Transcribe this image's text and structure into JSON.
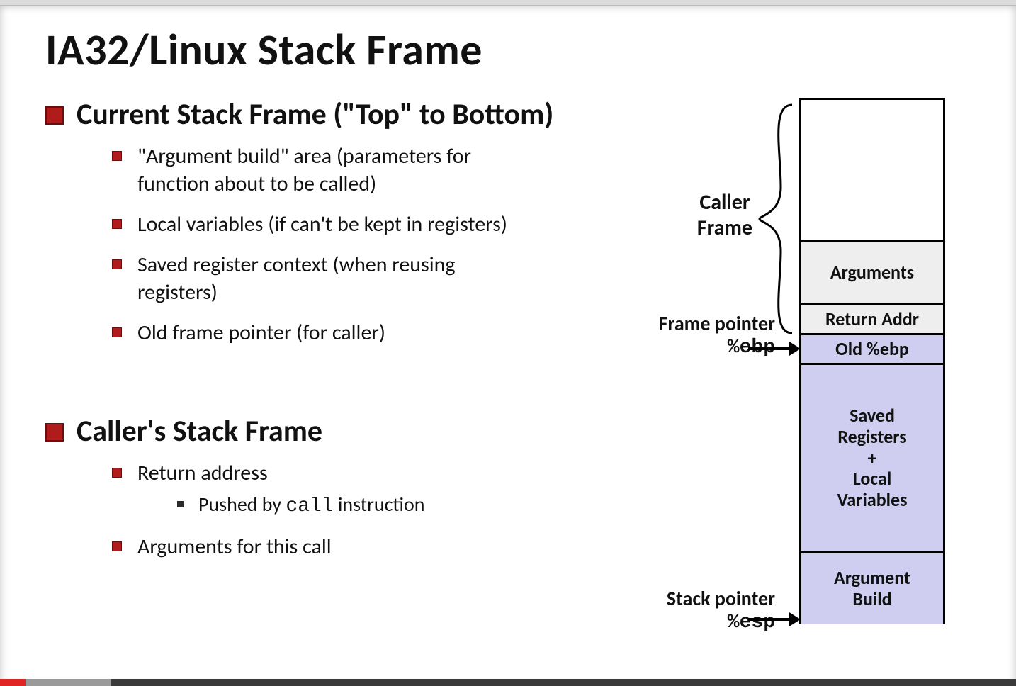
{
  "title": "IA32/Linux Stack Frame",
  "sections": [
    {
      "heading": "Current Stack Frame (\"Top\" to Bottom)",
      "items": [
        {
          "text": "\"Argument build\" area (parameters for function about to be called)"
        },
        {
          "text": "Local variables (if can't be kept in registers)"
        },
        {
          "text": "Saved register context (when reusing registers)"
        },
        {
          "text": "Old frame pointer (for caller)"
        }
      ]
    },
    {
      "heading": "Caller's Stack Frame",
      "items": [
        {
          "text": "Return address",
          "sub": [
            {
              "pre": "Pushed by ",
              "mono": "call",
              "post": " instruction"
            }
          ]
        },
        {
          "text": "Arguments for this call"
        }
      ]
    }
  ],
  "diagram": {
    "caller_label_line1": "Caller",
    "caller_label_line2": "Frame",
    "frame_pointer_label": "Frame pointer",
    "frame_pointer_reg": "%ebp",
    "stack_pointer_label": "Stack pointer",
    "stack_pointer_reg": "%esp",
    "cells": {
      "arguments": "Arguments",
      "return_addr": "Return Addr",
      "old_ebp": "Old %ebp",
      "saved": "Saved Registers + Local Variables",
      "arg_build": "Argument Build"
    }
  }
}
